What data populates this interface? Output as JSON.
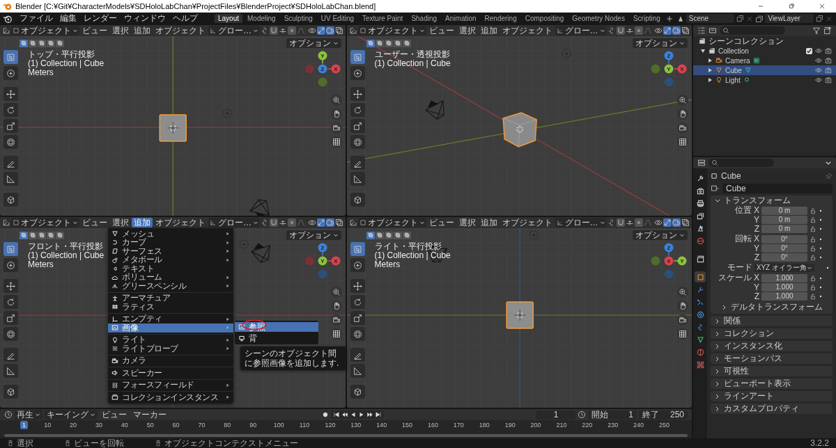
{
  "window": {
    "title": "Blender [C:¥Git¥CharacterModels¥SDHoloLabChan¥ProjectFiles¥BlenderProject¥SDHoloLabChan.blend]"
  },
  "menu": [
    "ファイル",
    "編集",
    "レンダー",
    "ウィンドウ",
    "ヘルプ"
  ],
  "workspaces": [
    {
      "label": "Layout",
      "selected": true
    },
    {
      "label": "Modeling",
      "selected": false
    },
    {
      "label": "Sculpting",
      "selected": false
    },
    {
      "label": "UV Editing",
      "selected": false
    },
    {
      "label": "Texture Paint",
      "selected": false
    },
    {
      "label": "Shading",
      "selected": false
    },
    {
      "label": "Animation",
      "selected": false
    },
    {
      "label": "Rendering",
      "selected": false
    },
    {
      "label": "Compositing",
      "selected": false
    },
    {
      "label": "Geometry Nodes",
      "selected": false
    },
    {
      "label": "Scripting",
      "selected": false
    }
  ],
  "scene": "Scene",
  "view_layer": "ViewLayer",
  "toolbar": [
    {
      "kind": "select",
      "selected": true
    },
    {
      "kind": "cursor",
      "selected": false
    },
    {
      "kind": "move",
      "selected": false
    },
    {
      "kind": "rotate",
      "selected": false
    },
    {
      "kind": "scale",
      "selected": false
    },
    {
      "kind": "transform",
      "selected": false
    },
    {
      "kind": "annotate",
      "selected": false
    },
    {
      "kind": "measure",
      "selected": false
    },
    {
      "kind": "addcube",
      "selected": false
    }
  ],
  "select_modes": [
    {
      "selected": true
    },
    {
      "selected": false
    },
    {
      "selected": false
    },
    {
      "selected": false
    },
    {
      "selected": false
    }
  ],
  "header_toggles": [
    {
      "kind": "visibility",
      "on": false
    },
    {
      "kind": "gizmo",
      "on": true
    },
    {
      "kind": "overlay",
      "on": true
    },
    {
      "kind": "xray",
      "on": false
    }
  ],
  "viewports": [
    {
      "kind": "top",
      "mode": "オブジェクト",
      "menus": [
        {
          "label": "ビュー",
          "selected": false
        },
        {
          "label": "選択",
          "selected": false
        },
        {
          "label": "追加",
          "selected": false
        },
        {
          "label": "オブジェクト",
          "selected": false
        }
      ],
      "orientation": "グロー…",
      "options": "オプション",
      "view": "トップ・平行投影",
      "context": "(1) Collection | Cube",
      "units": "Meters",
      "gizmo": [
        {
          "label": "Y",
          "color": "#8bc33c"
        },
        {
          "color": "#7a3038"
        },
        {
          "label": "Z",
          "color": "#3d82d6"
        },
        {
          "label": "X",
          "color": "#e0404f"
        },
        {
          "color": "#4f6d2a"
        }
      ]
    },
    {
      "kind": "persp",
      "mode": "オブジェクト",
      "menus": [
        {
          "label": "ビュー",
          "selected": false
        },
        {
          "label": "選択",
          "selected": false
        },
        {
          "label": "追加",
          "selected": false
        },
        {
          "label": "オブジェクト",
          "selected": false
        }
      ],
      "orientation": "グロー…",
      "options": "オプション",
      "view": "ユーザー・透視投影",
      "context": "(1) Collection | Cube",
      "gizmo": [
        {
          "label": "Z",
          "color": "#3d82d6"
        },
        {
          "color": "#4f6d2a"
        },
        {
          "label": "Y",
          "color": "#8bc33c"
        },
        {
          "label": "X",
          "color": "#e0404f"
        },
        {
          "color": "#2e4f78"
        }
      ]
    },
    {
      "kind": "front",
      "mode": "オブジェクト",
      "menus": [
        {
          "label": "ビュー",
          "selected": false
        },
        {
          "label": "選択",
          "selected": false
        },
        {
          "label": "追加",
          "selected": true
        },
        {
          "label": "オブジェクト",
          "selected": false
        }
      ],
      "orientation": "グロー…",
      "options": "オプション",
      "view": "フロント・平行投影",
      "context": "(1) Collection | Cube",
      "units": "Meters",
      "gizmo": [
        {
          "label": "Z",
          "color": "#3d82d6"
        },
        {
          "color": "#7a3038"
        },
        {
          "label": "Y",
          "color": "#8bc33c"
        },
        {
          "label": "X",
          "color": "#e0404f"
        },
        {
          "color": "#2e4f78"
        }
      ],
      "add_menu": {
        "groups": [
          [
            {
              "label": "メッシュ",
              "submenu": true,
              "selected": false
            },
            {
              "label": "カーブ",
              "submenu": true,
              "selected": false
            },
            {
              "label": "サーフェス",
              "submenu": true,
              "selected": false
            },
            {
              "label": "メタボール",
              "submenu": true,
              "selected": false
            },
            {
              "label": "テキスト",
              "submenu": false,
              "selected": false
            },
            {
              "label": "ボリューム",
              "submenu": true,
              "selected": false
            },
            {
              "label": "グリースペンシル",
              "submenu": true,
              "selected": false
            }
          ],
          [
            {
              "label": "アーマチュア",
              "submenu": false,
              "selected": false
            },
            {
              "label": "ラティス",
              "submenu": false,
              "selected": false
            }
          ],
          [
            {
              "label": "エンプティ",
              "submenu": true,
              "selected": false
            },
            {
              "label": "画像",
              "submenu": true,
              "selected": true
            }
          ],
          [
            {
              "label": "ライト",
              "submenu": true,
              "selected": false
            },
            {
              "label": "ライトプローブ",
              "submenu": true,
              "selected": false
            }
          ],
          [
            {
              "label": "カメラ",
              "submenu": false,
              "selected": false
            }
          ],
          [
            {
              "label": "スピーカー",
              "submenu": false,
              "selected": false
            }
          ],
          [
            {
              "label": "フォースフィールド",
              "submenu": true,
              "selected": false
            }
          ],
          [
            {
              "label": "コレクションインスタンス",
              "submenu": true,
              "selected": false
            }
          ]
        ],
        "submenu": [
          {
            "label": "参照",
            "selected": true
          },
          {
            "label": "背",
            "selected": false
          }
        ],
        "tooltip": "シーンのオブジェクト間に参照画像を追加します."
      }
    },
    {
      "kind": "right",
      "mode": "オブジェクト",
      "menus": [
        {
          "label": "ビュー",
          "selected": false
        },
        {
          "label": "選択",
          "selected": false
        },
        {
          "label": "追加",
          "selected": false
        },
        {
          "label": "オブジェクト",
          "selected": false
        }
      ],
      "orientation": "グロー…",
      "options": "オプション",
      "view": "ライト・平行投影",
      "context": "(1) Collection | Cube",
      "units": "Meters",
      "gizmo": [
        {
          "label": "Z",
          "color": "#3d82d6"
        },
        {
          "color": "#4f6d2a"
        },
        {
          "label": "X",
          "color": "#e0404f"
        },
        {
          "label": "Y",
          "color": "#8bc33c"
        },
        {
          "color": "#2e4f78"
        }
      ]
    }
  ],
  "outliner": {
    "root": "シーンコレクション",
    "collection": {
      "label": "Collection",
      "expanded": true,
      "checked": true,
      "children": [
        {
          "label": "Camera",
          "kind": "camera",
          "expanded": false,
          "selected": false
        },
        {
          "label": "Cube",
          "kind": "mesh",
          "expanded": false,
          "selected": true
        },
        {
          "label": "Light",
          "kind": "light",
          "expanded": false,
          "selected": false
        }
      ]
    }
  },
  "properties": {
    "tabs": [
      {
        "kind": "tool",
        "selected": false
      },
      {
        "kind": "render",
        "selected": false
      },
      {
        "kind": "output",
        "selected": false
      },
      {
        "kind": "viewlayer",
        "selected": false
      },
      {
        "kind": "scene",
        "selected": false
      },
      {
        "kind": "world",
        "selected": false
      },
      {
        "kind": "collection",
        "selected": false
      },
      {
        "kind": "object",
        "selected": true
      },
      {
        "kind": "modifier",
        "selected": false
      },
      {
        "kind": "particles",
        "selected": false
      },
      {
        "kind": "physics",
        "selected": false
      },
      {
        "kind": "constraint",
        "selected": false
      },
      {
        "kind": "data",
        "selected": false
      },
      {
        "kind": "material",
        "selected": false
      },
      {
        "kind": "texture",
        "selected": false
      }
    ],
    "object": "Cube",
    "datablock": "Cube",
    "transform": {
      "label": "トランスフォーム",
      "expanded": true,
      "groups": [
        {
          "label": "位置",
          "rows": [
            {
              "axis": "X",
              "value": "0 m"
            },
            {
              "axis": "Y",
              "value": "0 m"
            },
            {
              "axis": "Z",
              "value": "0 m"
            }
          ]
        },
        {
          "label": "回転",
          "rows": [
            {
              "axis": "X",
              "value": "0°"
            },
            {
              "axis": "Y",
              "value": "0°"
            },
            {
              "axis": "Z",
              "value": "0°"
            }
          ]
        }
      ],
      "mode": {
        "label": "モード",
        "value": "XYZ オイラー角"
      },
      "scale": {
        "label": "スケール",
        "rows": [
          {
            "axis": "X",
            "value": "1.000"
          },
          {
            "axis": "Y",
            "value": "1.000"
          },
          {
            "axis": "Z",
            "value": "1.000"
          }
        ]
      },
      "delta": {
        "label": "デルタトランスフォーム",
        "expanded": false
      }
    },
    "panels": [
      {
        "label": "関係",
        "expanded": false
      },
      {
        "label": "コレクション",
        "expanded": false
      },
      {
        "label": "インスタンス化",
        "expanded": false
      },
      {
        "label": "モーションパス",
        "expanded": false
      },
      {
        "label": "可視性",
        "expanded": false
      },
      {
        "label": "ビューポート表示",
        "expanded": false
      },
      {
        "label": "ラインアート",
        "expanded": false
      },
      {
        "label": "カスタムプロパティ",
        "expanded": false
      }
    ]
  },
  "timeline": {
    "menus": [
      {
        "label": "再生",
        "dropdown": true
      },
      {
        "label": "キーイング",
        "dropdown": true
      },
      {
        "label": "ビュー",
        "dropdown": false
      },
      {
        "label": "マーカー",
        "dropdown": false
      }
    ],
    "current_frame": "1",
    "start_label": "開始",
    "start": "1",
    "end_label": "終了",
    "end": "250",
    "playhead": "1",
    "ruler": [
      "10",
      "20",
      "30",
      "40",
      "50",
      "60",
      "70",
      "80",
      "90",
      "100",
      "110",
      "120",
      "130",
      "140",
      "150",
      "160",
      "170",
      "180",
      "190",
      "200",
      "210",
      "220",
      "230",
      "240",
      "250"
    ]
  },
  "status": [
    "選択",
    "ビューを回転",
    "オブジェクトコンテクストメニュー"
  ],
  "version": "3.2.2"
}
